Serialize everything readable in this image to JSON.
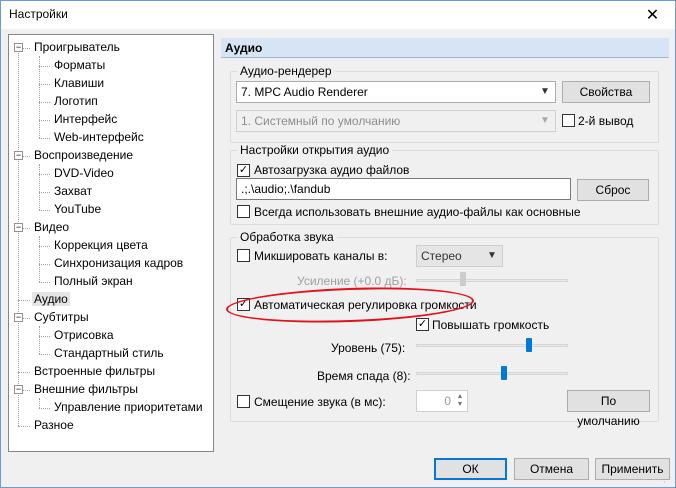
{
  "window": {
    "title": "Настройки",
    "close_symbol": "✕"
  },
  "tree": {
    "items": [
      {
        "label": "Проигрыватель",
        "level": 0,
        "expander": "−"
      },
      {
        "label": "Форматы",
        "level": 1
      },
      {
        "label": "Клавиши",
        "level": 1
      },
      {
        "label": "Логотип",
        "level": 1
      },
      {
        "label": "Интерфейс",
        "level": 1
      },
      {
        "label": "Web-интерфейс",
        "level": 1
      },
      {
        "label": "Воспроизведение",
        "level": 0,
        "expander": "−"
      },
      {
        "label": "DVD-Video",
        "level": 1
      },
      {
        "label": "Захват",
        "level": 1
      },
      {
        "label": "YouTube",
        "level": 1
      },
      {
        "label": "Видео",
        "level": 0,
        "expander": "−"
      },
      {
        "label": "Коррекция цвета",
        "level": 1
      },
      {
        "label": "Синхронизация кадров",
        "level": 1
      },
      {
        "label": "Полный экран",
        "level": 1
      },
      {
        "label": "Аудио",
        "level": 0,
        "selected": true
      },
      {
        "label": "Субтитры",
        "level": 0,
        "expander": "−"
      },
      {
        "label": "Отрисовка",
        "level": 1
      },
      {
        "label": "Стандартный стиль",
        "level": 1
      },
      {
        "label": "Встроенные фильтры",
        "level": 0
      },
      {
        "label": "Внешние фильтры",
        "level": 0,
        "expander": "−"
      },
      {
        "label": "Управление приоритетами",
        "level": 1
      },
      {
        "label": "Разное",
        "level": 0
      }
    ]
  },
  "panel": {
    "header": "Аудио",
    "renderer_group": {
      "legend": "Аудио-рендерер",
      "renderer_value": "7. MPC Audio Renderer",
      "properties_label": "Свойства",
      "second_output_value": "1. Системный по умолчанию",
      "second_output_check_label": "2-й вывод",
      "second_output_checked": false
    },
    "opening_group": {
      "legend": "Настройки открытия аудио",
      "autoload_label": "Автозагрузка аудио файлов",
      "autoload_checked": true,
      "paths_value": ".;.\\audio;.\\fandub",
      "reset_label": "Сброс",
      "always_external_label": "Всегда использовать внешние аудио-файлы как основные",
      "always_external_checked": false
    },
    "processing_group": {
      "legend": "Обработка звука",
      "mix_label": "Микшировать каналы в:",
      "mix_checked": false,
      "mix_value": "Стерео",
      "gain_label": "Усиление (+0.0 дБ):",
      "gain_level": 0.3,
      "auto_volume_label": "Автоматическая регулировка громкости",
      "auto_volume_checked": true,
      "boost_label": "Повышать громкость",
      "boost_checked": true,
      "level_label": "Уровень (75):",
      "level_value": 0.75,
      "fall_label": "Время спада (8):",
      "fall_value": 0.58,
      "shift_label": "Смещение звука (в мс):",
      "shift_checked": false,
      "shift_value": "0",
      "defaults_label": "По умолчанию"
    }
  },
  "buttons": {
    "ok": "ОК",
    "cancel": "Отмена",
    "apply": "Применить"
  },
  "check_mark": "✓",
  "colors": {
    "accent": "#0078d7",
    "annotation": "#e0121c",
    "header_bg": "#d6e4f5"
  }
}
